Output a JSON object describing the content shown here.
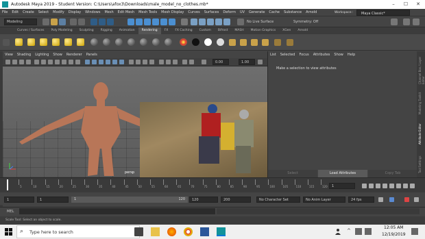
{
  "window": {
    "title": "Autodesk Maya 2019 - Student Version: C:\\Users\\afox3\\Downloads\\male_model_no_clothes.mb*"
  },
  "menubar": [
    "File",
    "Edit",
    "Create",
    "Select",
    "Modify",
    "Display",
    "Windows",
    "Mesh",
    "Edit Mesh",
    "Mesh Tools",
    "Mesh Display",
    "Curves",
    "Surfaces",
    "Deform",
    "UV",
    "Generate",
    "Cache",
    "Substance",
    "Arnold"
  ],
  "workspace": {
    "label": "Workspace :",
    "value": "Maya Classic*"
  },
  "status": {
    "mode": "Modeling",
    "live_surface": "No Live Surface",
    "symmetry": "Symmetry: Off"
  },
  "shelf_tabs": [
    "Curves / Surfaces",
    "Poly Modeling",
    "Sculpting",
    "Rigging",
    "Animation",
    "Rendering",
    "FX",
    "FX Caching",
    "Custom",
    "Bifrost",
    "MASH",
    "Motion Graphics",
    "XGen",
    "Arnold"
  ],
  "active_shelf_tab": "Rendering",
  "viewport": {
    "menu": [
      "View",
      "Shading",
      "Lighting",
      "Show",
      "Renderer",
      "Panels"
    ],
    "near": "0.00",
    "far": "1.00",
    "camera_label": "persp"
  },
  "attribute_editor": {
    "menu": [
      "List",
      "Selected",
      "Focus",
      "Attributes",
      "Show",
      "Help"
    ],
    "message": "Make a selection to view attributes",
    "buttons": {
      "select": "Select",
      "load": "Load Attributes",
      "copy": "Copy Tab"
    }
  },
  "side_tabs": [
    "Channel Box / Layer Editor",
    "Modeling Toolkit",
    "Attribute Editor",
    "Tool Settings"
  ],
  "time_slider": {
    "ticks": [
      "5",
      "10",
      "15",
      "20",
      "25",
      "30",
      "35",
      "40",
      "45",
      "50",
      "55",
      "60",
      "65",
      "70",
      "75",
      "80",
      "85",
      "90",
      "95",
      "100",
      "105",
      "110",
      "115",
      "120"
    ],
    "current_frame": "1"
  },
  "range": {
    "start": "1",
    "anim_start": "1",
    "slider_start": "1",
    "slider_end": "120",
    "anim_end": "120",
    "end": "200",
    "character_set": "No Character Set",
    "anim_layer": "No Anim Layer",
    "fps": "24 fps"
  },
  "command_line": {
    "label": "MEL"
  },
  "help_line": "Scale Tool: Select an object to scale.",
  "taskbar": {
    "search_placeholder": "Type here to search",
    "time": "12:05 AM",
    "date": "12/19/2019"
  },
  "colors": {
    "accent": "#5285a6",
    "selected_icon": "#4b8fd1"
  }
}
